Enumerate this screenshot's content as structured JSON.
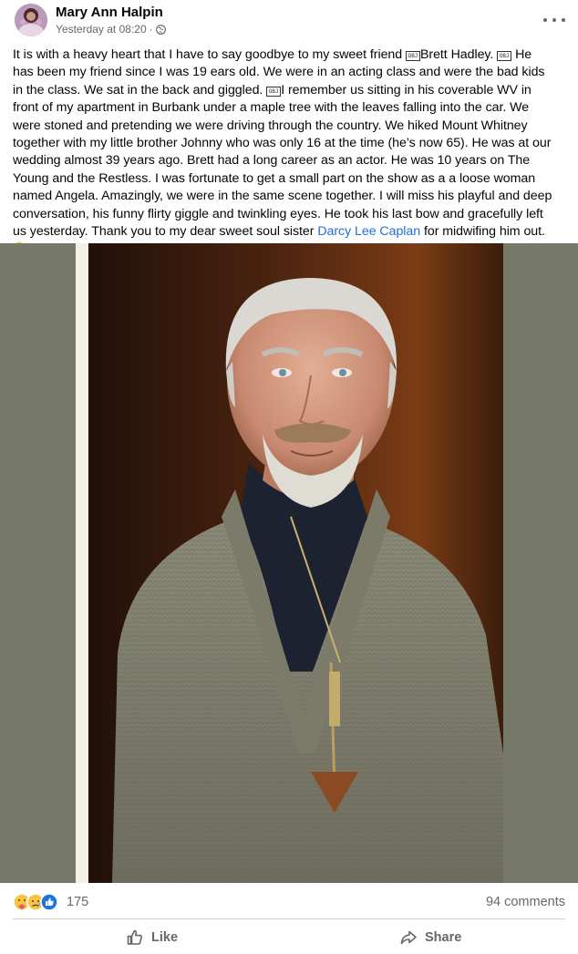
{
  "post": {
    "author": "Mary Ann Halpin",
    "timestamp": "Yesterday at 08:20",
    "more_icon": "more-horizontal-icon",
    "audience_icon": "globe-icon",
    "obj_glyph": "OBJ",
    "text_1": "It is with a heavy heart that I have to say goodbye to my sweet friend ",
    "text_2": "Brett Hadley. ",
    "text_3": " He has been my friend since I was 19 ears old. We were in an acting class and were the bad kids in the class. We sat in the back and giggled. ",
    "text_4": "I remember us sitting in his coverable WV in front of my apartment in Burbank under a maple tree with the leaves falling into the car. We were stoned and pretending we were driving through the country. We hiked Mount Whitney together with my little brother Johnny who was only 16 at the time (he’s now 65). He was at our wedding almost 39 years ago. Brett had a long career as an actor. He was 10 years on The Young and the Restless. I was fortunate to get a small part on the show as a a loose woman named Angela. Amazingly, we were in the same scene together. I will miss his playful and deep conversation, his funny flirty giggle and twinkling eyes. He took his last bow and gracefully left us yesterday. Thank you to my dear sweet soul sister ",
    "mention": "Darcy Lee Caplan",
    "text_5": " for midwifing him out.  ",
    "trailing_emojis": [
      "sad-face-emoji",
      "red-heart-emoji"
    ]
  },
  "reactions": {
    "icons": [
      "care-reaction-icon",
      "sad-reaction-icon",
      "like-reaction-icon"
    ],
    "count": "175",
    "comments": "94 comments"
  },
  "actions": {
    "like_label": "Like",
    "share_label": "Share"
  },
  "colors": {
    "link": "#216fdb",
    "secondary_text": "#65676b",
    "photo_border": "#767968"
  }
}
